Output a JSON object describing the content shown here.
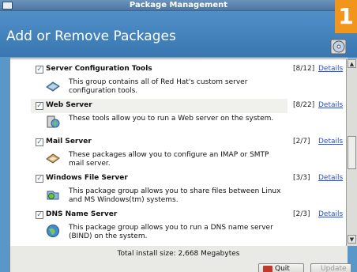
{
  "window": {
    "title": "Package Management"
  },
  "header": {
    "title": "Add or Remove Packages"
  },
  "badge": {
    "number": "1"
  },
  "packages": [
    {
      "name": "Server Configuration Tools",
      "count": "[8/12]",
      "details": "Details",
      "checked": true,
      "desc": "This group contains all of Red Hat's custom server configuration tools.",
      "icon": "server-config-icon"
    },
    {
      "name": "Web Server",
      "count": "[8/22]",
      "details": "Details",
      "checked": true,
      "selected": true,
      "desc": "These tools allow you to run a Web server on the system.",
      "icon": "web-server-icon"
    },
    {
      "name": "Mail Server",
      "count": "[2/7]",
      "details": "Details",
      "checked": true,
      "desc": "These packages allow you to configure an IMAP or SMTP mail server.",
      "icon": "mail-server-icon"
    },
    {
      "name": "Windows File Server",
      "count": "[3/3]",
      "details": "Details",
      "checked": true,
      "desc": "This package group allows you to share files between Linux and MS Windows(tm) systems.",
      "icon": "windows-file-server-icon"
    },
    {
      "name": "DNS Name Server",
      "count": "[2/3]",
      "details": "Details",
      "checked": true,
      "desc": "This package group allows you to run a DNS name server (BIND) on the system.",
      "icon": "dns-server-icon"
    }
  ],
  "footer": {
    "total": "Total install size: 2,668 Megabytes",
    "quit_label": "Quit",
    "update_label": "Update"
  },
  "colors": {
    "accent": "#f2951c",
    "header": "#4f8fc6",
    "link": "#2a53c2"
  }
}
